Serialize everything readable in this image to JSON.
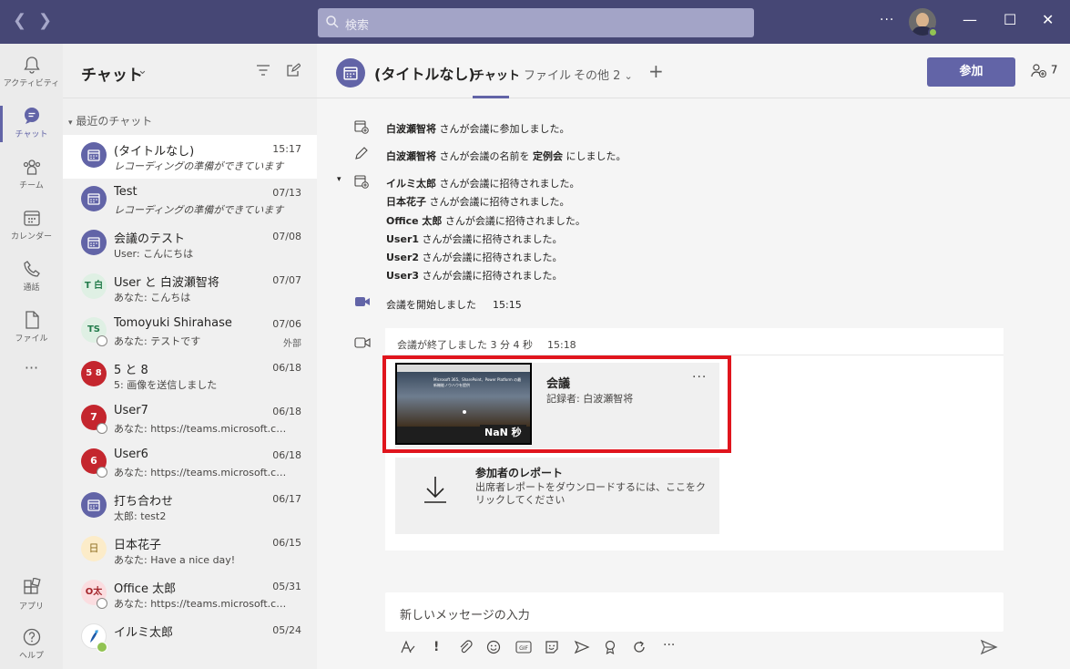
{
  "titlebar": {
    "search_placeholder": "検索",
    "more": "···",
    "minimize": "—",
    "maximize": "☐",
    "close": "✕",
    "colors": {
      "bar": "#464775",
      "search": "#a3a4c7",
      "status_available": "#92c353"
    }
  },
  "rail": {
    "items": [
      {
        "label": "アクティビティ",
        "icon": "bell-icon"
      },
      {
        "label": "チャット",
        "icon": "chat-icon"
      },
      {
        "label": "チーム",
        "icon": "teams-icon"
      },
      {
        "label": "カレンダー",
        "icon": "calendar-icon"
      },
      {
        "label": "通話",
        "icon": "phone-icon"
      },
      {
        "label": "ファイル",
        "icon": "file-icon"
      },
      {
        "label": "アプリ",
        "icon": "apps-icon"
      },
      {
        "label": "ヘルプ",
        "icon": "help-icon"
      }
    ],
    "more": "···",
    "active_color": "#6264a7"
  },
  "chatlist": {
    "title": "チャット",
    "section": "最近のチャット",
    "items": [
      {
        "name": "(タイトルなし)",
        "preview": "レコーディングの準備ができています",
        "time": "15:17"
      },
      {
        "name": "Test",
        "preview": "レコーディングの準備ができています",
        "time": "07/13"
      },
      {
        "name": "会議のテスト",
        "preview": "User: こんにちは",
        "time": "07/08"
      },
      {
        "name": "User と 白波瀬智将",
        "preview": "あなた: こんちは",
        "time": "07/07",
        "avatar": "T 白"
      },
      {
        "name": "Tomoyuki Shirahase",
        "preview": "あなた: テストです",
        "time": "07/06",
        "extra": "外部",
        "avatar": "TS"
      },
      {
        "name": "5 と 8",
        "preview": "5: 画像を送信しました",
        "time": "06/18",
        "avatar": "5 8"
      },
      {
        "name": "User7",
        "preview": "あなた: https://teams.microsoft.co...",
        "time": "06/18",
        "avatar": "7"
      },
      {
        "name": "User6",
        "preview": "あなた: https://teams.microsoft.co...",
        "time": "06/18",
        "avatar": "6"
      },
      {
        "name": "打ち合わせ",
        "preview": "太郎: test2",
        "time": "06/17"
      },
      {
        "name": "日本花子",
        "preview": "あなた: Have a nice day!",
        "time": "06/15",
        "avatar": "日"
      },
      {
        "name": "Office 太郎",
        "preview": "あなた: https://teams.microsoft.co...",
        "time": "05/31",
        "avatar": "O太"
      },
      {
        "name": "イルミ太郎",
        "preview": "",
        "time": "05/24"
      }
    ]
  },
  "main": {
    "title": "(タイトルなし)",
    "tabs": [
      "チャット",
      "ファイル",
      "その他 2"
    ],
    "join_label": "参加",
    "people_count": "7",
    "events": {
      "e1_name": "白波瀬智将",
      "e1_text": " さんが会議に参加しました。",
      "e2_name": "白波瀬智将",
      "e2_text": " さんが会議の名前を ",
      "e2_value": "定例会",
      "e2_tail": " にしました。",
      "invites": [
        {
          "name": "イルミ太郎",
          "text": " さんが会議に招待されました。"
        },
        {
          "name": "日本花子",
          "text": " さんが会議に招待されました。"
        },
        {
          "name": "Office 太郎",
          "text": " さんが会議に招待されました。"
        },
        {
          "name": "User1",
          "text": " さんが会議に招待されました。"
        },
        {
          "name": "User2",
          "text": " さんが会議に招待されました。"
        },
        {
          "name": "User3",
          "text": " さんが会議に招待されました。"
        }
      ],
      "started": "会議を開始しました",
      "started_time": "15:15",
      "ended": "会議が終了しました  3 分 4 秒",
      "ended_time": "15:18"
    },
    "recording": {
      "title": "会議",
      "by": "記録者: 白波瀬智将",
      "duration": "NaN 秒",
      "thumb_text": "Microsoft 365、SharePoint、Power Platform の最新機能ノウハウを提供"
    },
    "report": {
      "title": "参加者のレポート",
      "desc": "出席者レポートをダウンロードするには、ここをクリックしてください"
    },
    "compose_placeholder": "新しいメッセージの入力",
    "highlight_color": "#e0151d"
  }
}
